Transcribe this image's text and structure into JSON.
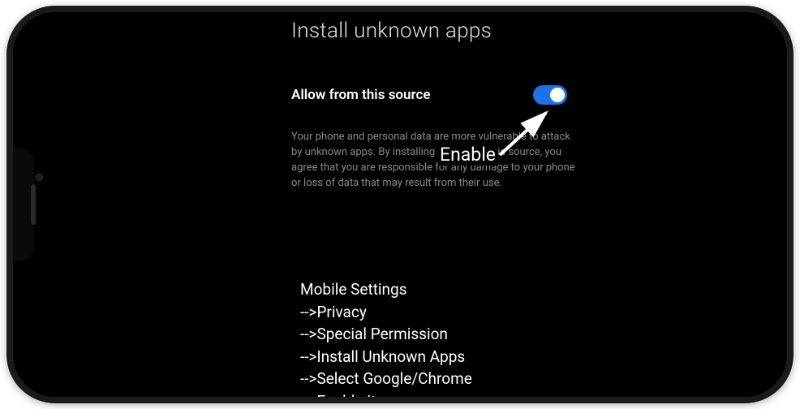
{
  "header": {
    "title": "Install unknown apps"
  },
  "setting": {
    "label": "Allow from this source",
    "enabled": true
  },
  "description": "Your phone and personal data are more vulnerable to attack by unknown apps. By installing apps from this source, you agree that you are responsible for any damage to your phone or loss of data that may result from their use.",
  "annotation": {
    "enable_label": "Enable"
  },
  "instructions": {
    "heading": "Mobile Settings",
    "steps": [
      "-->Privacy",
      "-->Special Permission",
      "-->Install Unknown Apps",
      "-->Select Google/Chrome",
      "-->Enable It"
    ]
  }
}
